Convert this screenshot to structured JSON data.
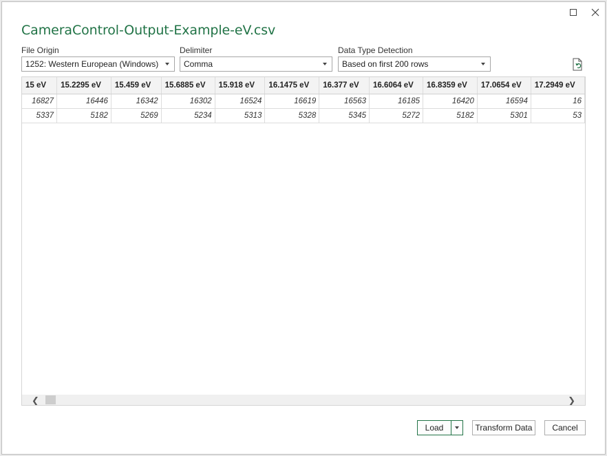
{
  "window": {
    "title": "CameraControl-Output-Example-eV.csv",
    "maximize_icon": "maximize-icon",
    "close_icon": "close-icon"
  },
  "options": {
    "file_origin": {
      "label": "File Origin",
      "value": "1252: Western European (Windows)"
    },
    "delimiter": {
      "label": "Delimiter",
      "value": "Comma"
    },
    "data_type_detection": {
      "label": "Data Type Detection",
      "value": "Based on first 200 rows"
    },
    "refresh_icon": "document-refresh-icon"
  },
  "preview": {
    "columns": [
      "15 eV",
      "15.2295 eV",
      "15.459 eV",
      "15.6885 eV",
      "15.918 eV",
      "16.1475 eV",
      "16.377 eV",
      "16.6064 eV",
      "16.8359 eV",
      "17.0654 eV",
      "17.2949 eV"
    ],
    "rows": [
      [
        "16827",
        "16446",
        "16342",
        "16302",
        "16524",
        "16619",
        "16563",
        "16185",
        "16420",
        "16594",
        "16"
      ],
      [
        "5337",
        "5182",
        "5269",
        "5234",
        "5313",
        "5328",
        "5345",
        "5272",
        "5182",
        "5301",
        "53"
      ]
    ]
  },
  "buttons": {
    "load": "Load",
    "transform": "Transform Data",
    "cancel": "Cancel"
  },
  "colors": {
    "accent": "#217346"
  }
}
